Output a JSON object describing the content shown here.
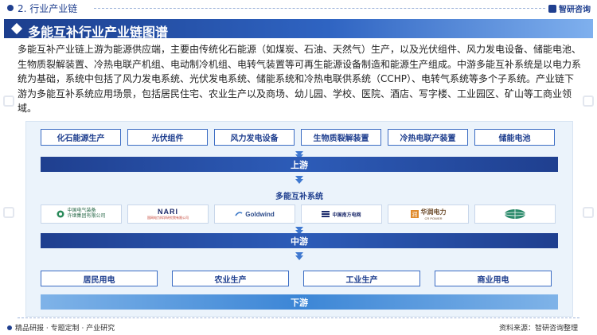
{
  "header": {
    "section_title": "2. 行业产业链",
    "logo_text": "智研咨询"
  },
  "banner": {
    "title": "多能互补行业产业链图谱"
  },
  "description": "多能互补产业链上游为能源供应端，主要由传统化石能源（如煤炭、石油、天然气）生产，以及光伏组件、风力发电设备、储能电池、生物质裂解装置、冷热电联产机组、电动制冷机组、电转气装置等可再生能源设备制造和能源生产组成。中游多能互补系统是以电力系统为基础，系统中包括了风力发电系统、光伏发电系统、储能系统和冷热电联供系统（CCHP）、电转气系统等多个子系统。产业链下游为多能互补系统应用场景，包括居民住宅、农业生产以及商场、幼儿园、学校、医院、酒店、写字楼、工业园区、矿山等工商业领域。",
  "upstream": {
    "items": [
      "化石能源生产",
      "光伏组件",
      "风力发电设备",
      "生物质裂解装置",
      "冷热电联产装置",
      "储能电池"
    ],
    "label": "上游"
  },
  "midstream": {
    "title": "多能互补系统",
    "logos": [
      {
        "name": "中国电气装备",
        "icon": "china-electric-logo",
        "lines": [
          "中国电气装备",
          "许继集团有限公司"
        ]
      },
      {
        "name": "NARI",
        "icon": "nari-logo",
        "lines": [
          "NARI",
          "国网电力科学研究院有限公司"
        ]
      },
      {
        "name": "Goldwind",
        "icon": "goldwind-logo",
        "lines": [
          "Goldwind"
        ]
      },
      {
        "name": "中国南方电网",
        "icon": "csg-logo",
        "lines": [
          "中国南方电网"
        ]
      },
      {
        "name": "华润电力",
        "icon": "cr-power-logo",
        "lines": [
          "华润电力",
          "CR POWER"
        ]
      },
      {
        "name": "电网",
        "icon": "grid-globe-logo",
        "lines": []
      }
    ],
    "label": "中游"
  },
  "downstream": {
    "items": [
      "居民用电",
      "农业生产",
      "工业生产",
      "商业用电"
    ],
    "label": "下游"
  },
  "footer": {
    "left": "精品研报 · 专题定制 · 产业研究",
    "right": "资料来源：智研咨询整理"
  },
  "colors": {
    "primary": "#1f3f8f",
    "accent": "#3f78d0",
    "panel": "#ebf3fb"
  }
}
